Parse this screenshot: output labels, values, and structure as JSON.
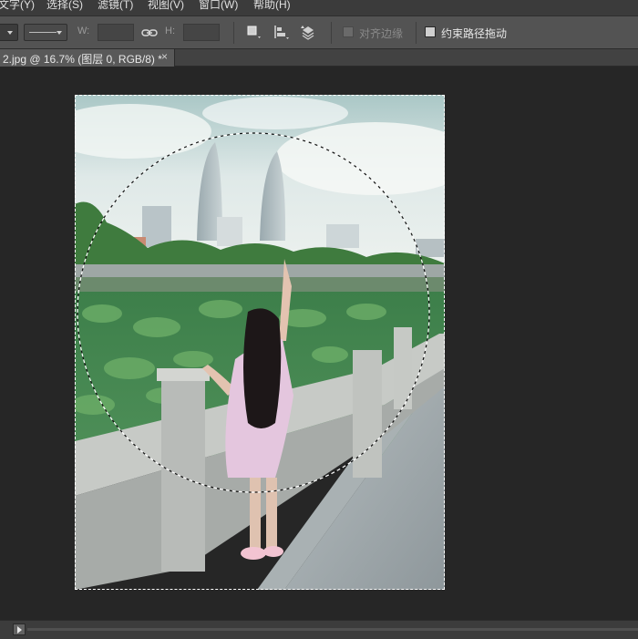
{
  "menu": {
    "items": [
      {
        "id": "text",
        "label": "文字(Y)"
      },
      {
        "id": "select",
        "label": "选择(S)"
      },
      {
        "id": "filter",
        "label": "滤镜(T)"
      },
      {
        "id": "view",
        "label": "视图(V)"
      },
      {
        "id": "window",
        "label": "窗口(W)"
      },
      {
        "id": "help",
        "label": "帮助(H)"
      }
    ]
  },
  "options": {
    "w_label": "W:",
    "h_label": "H:",
    "w_value": "",
    "h_value": "",
    "align_edges_label": "对齐边缘",
    "constrain_path_label": "约束路径拖动",
    "align_edges_enabled": false,
    "constrain_path_checked": false
  },
  "document_tab": {
    "title": "2.jpg @ 16.7% (图层 0, RGB/8) *",
    "close_glyph": "×"
  },
  "colors": {
    "app_bg": "#262626",
    "menu_bg": "#3b3b3b",
    "options_bg": "#535353",
    "tab_active": "#595959"
  },
  "icons": [
    "link-icon",
    "path-operations-icon",
    "path-alignment-icon",
    "path-arrangement-icon",
    "play-icon",
    "close-icon"
  ]
}
